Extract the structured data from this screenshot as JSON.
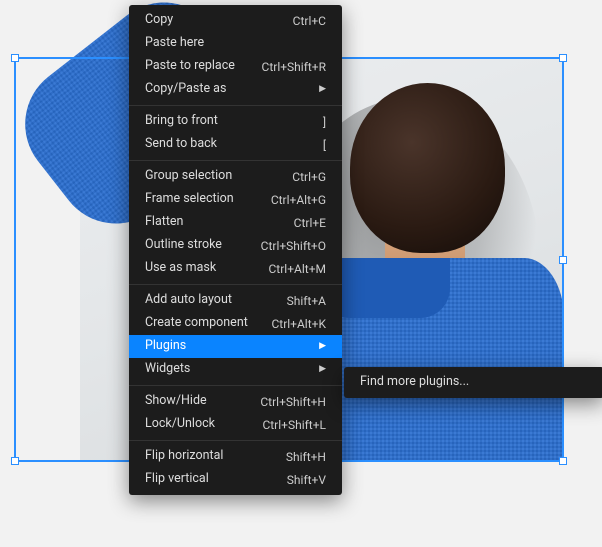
{
  "menu_groups": [
    [
      {
        "label": "Copy",
        "shortcut": "Ctrl+C"
      },
      {
        "label": "Paste here",
        "shortcut": ""
      },
      {
        "label": "Paste to replace",
        "shortcut": "Ctrl+Shift+R"
      },
      {
        "label": "Copy/Paste as",
        "shortcut": "",
        "submenu": true
      }
    ],
    [
      {
        "label": "Bring to front",
        "shortcut": "]"
      },
      {
        "label": "Send to back",
        "shortcut": "["
      }
    ],
    [
      {
        "label": "Group selection",
        "shortcut": "Ctrl+G"
      },
      {
        "label": "Frame selection",
        "shortcut": "Ctrl+Alt+G"
      },
      {
        "label": "Flatten",
        "shortcut": "Ctrl+E"
      },
      {
        "label": "Outline stroke",
        "shortcut": "Ctrl+Shift+O"
      },
      {
        "label": "Use as mask",
        "shortcut": "Ctrl+Alt+M"
      }
    ],
    [
      {
        "label": "Add auto layout",
        "shortcut": "Shift+A"
      },
      {
        "label": "Create component",
        "shortcut": "Ctrl+Alt+K"
      },
      {
        "label": "Plugins",
        "shortcut": "",
        "submenu": true,
        "highlighted": true
      },
      {
        "label": "Widgets",
        "shortcut": "",
        "submenu": true
      }
    ],
    [
      {
        "label": "Show/Hide",
        "shortcut": "Ctrl+Shift+H"
      },
      {
        "label": "Lock/Unlock",
        "shortcut": "Ctrl+Shift+L"
      }
    ],
    [
      {
        "label": "Flip horizontal",
        "shortcut": "Shift+H"
      },
      {
        "label": "Flip vertical",
        "shortcut": "Shift+V"
      }
    ]
  ],
  "submenu": {
    "label": "Find more plugins..."
  }
}
